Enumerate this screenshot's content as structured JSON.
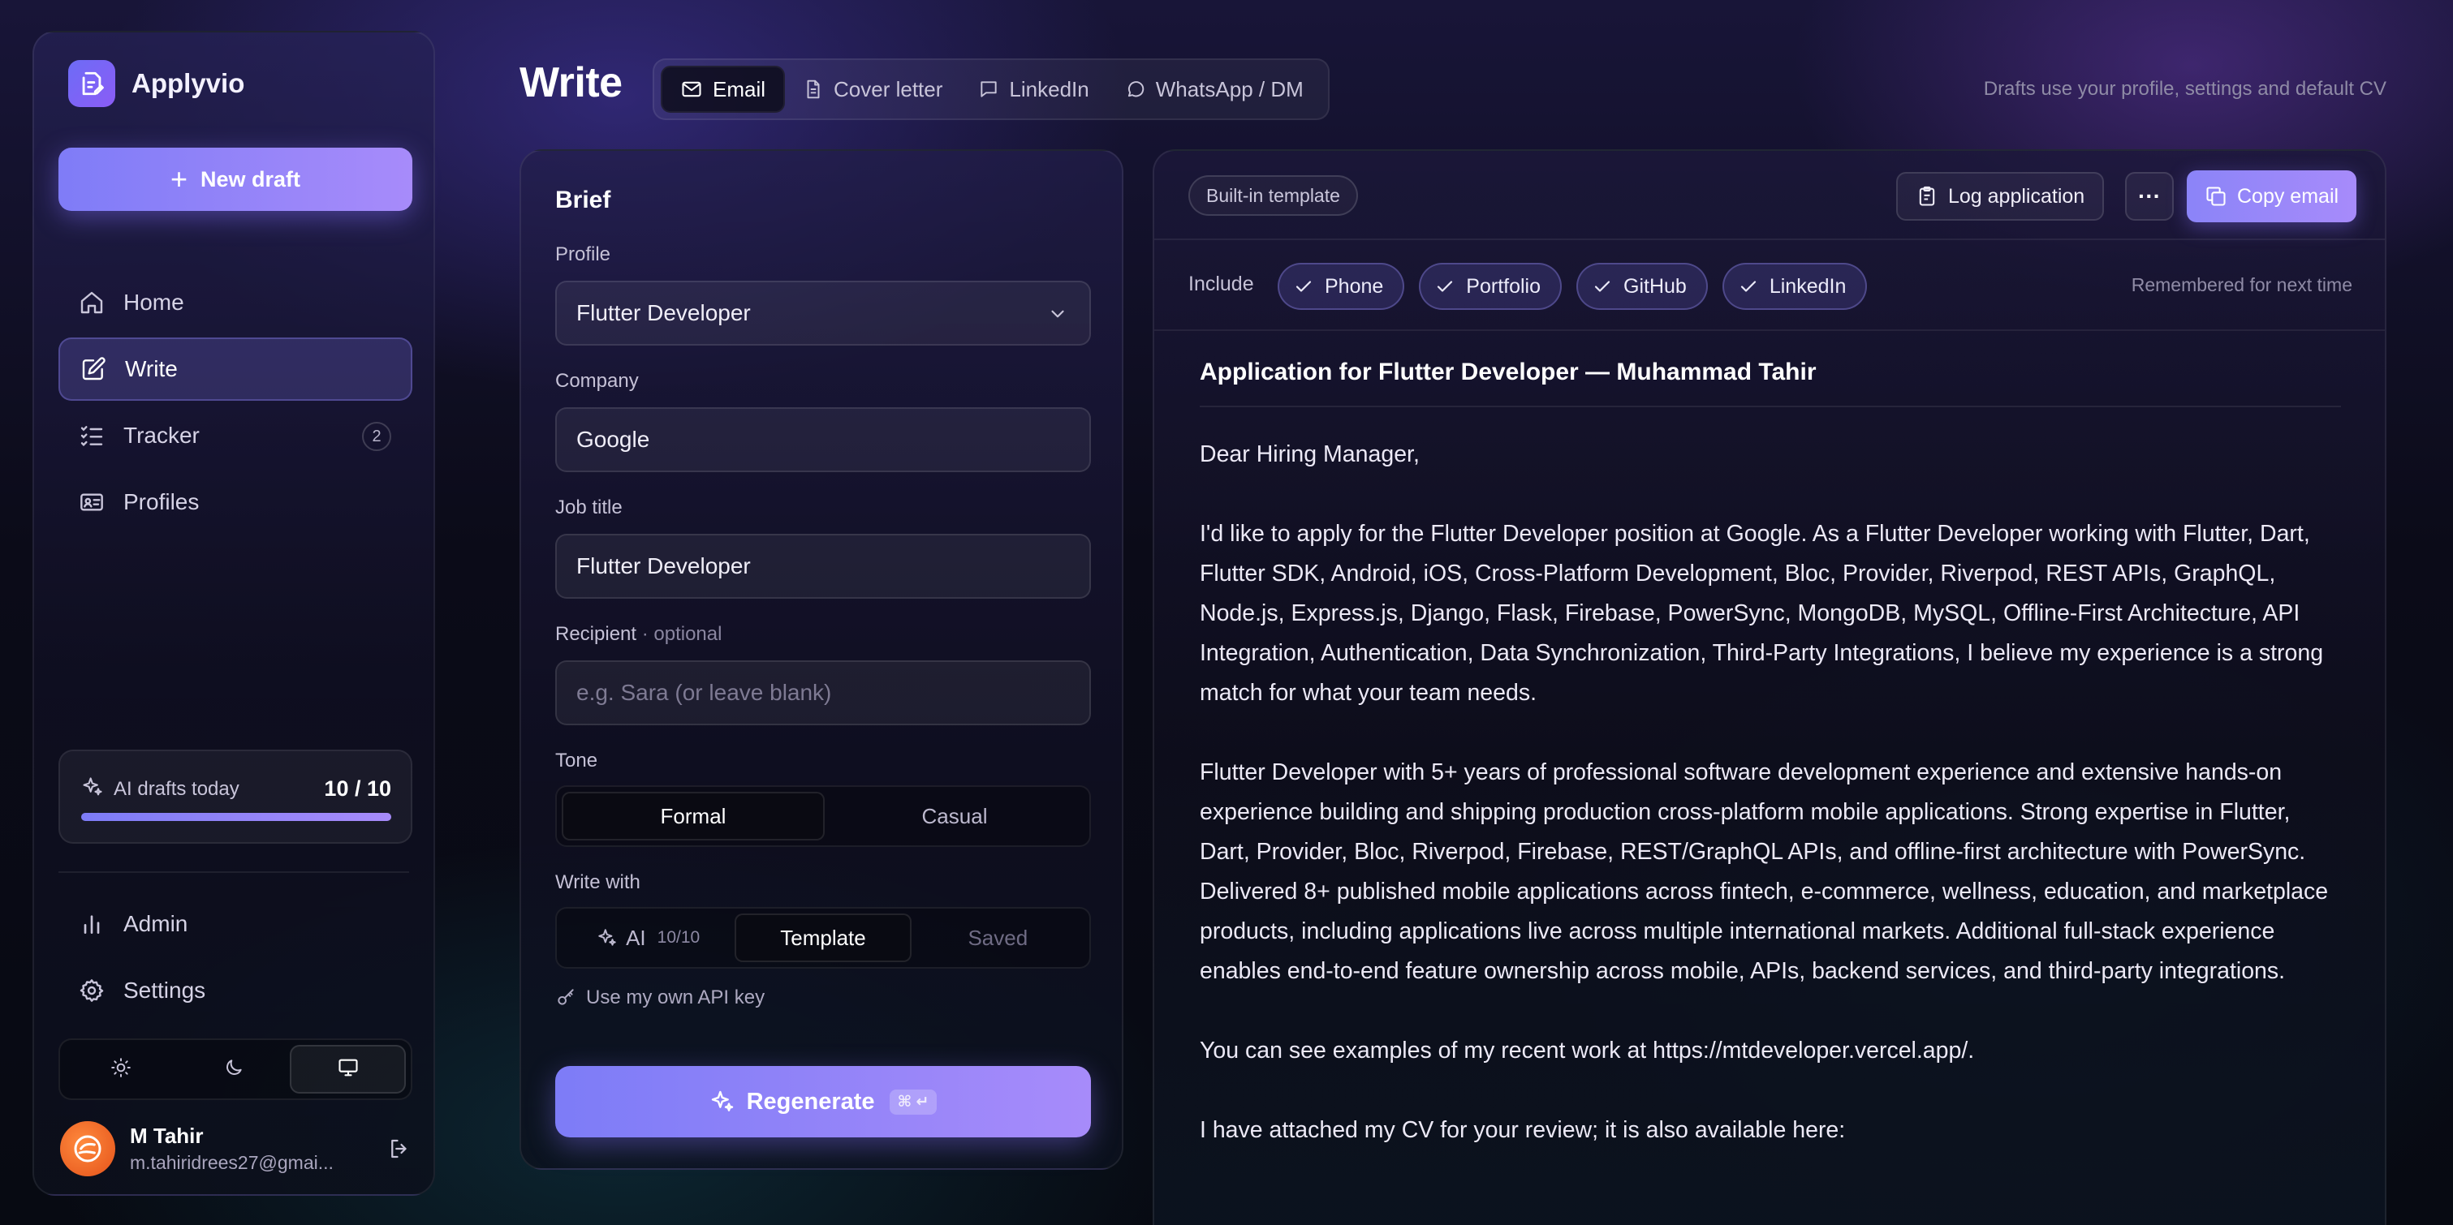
{
  "app": {
    "name": "Applyvio"
  },
  "sidebar": {
    "new_draft_label": "New draft",
    "nav": [
      {
        "label": "Home",
        "icon": "home-icon"
      },
      {
        "label": "Write",
        "icon": "edit-icon",
        "active": true
      },
      {
        "label": "Tracker",
        "icon": "checklist-icon",
        "badge": "2"
      },
      {
        "label": "Profiles",
        "icon": "id-card-icon"
      }
    ],
    "ai_drafts": {
      "label": "AI drafts today",
      "value": "10 / 10",
      "fraction": 1.0
    },
    "admin_label": "Admin",
    "settings_label": "Settings",
    "theme_options": [
      "light",
      "dark",
      "system"
    ],
    "theme_selected": "system",
    "user": {
      "name": "M Tahir",
      "email": "m.tahiridrees27@gmai..."
    }
  },
  "header": {
    "title": "Write",
    "tabs": [
      {
        "label": "Email",
        "icon": "mail-icon",
        "active": true
      },
      {
        "label": "Cover letter",
        "icon": "document-icon"
      },
      {
        "label": "LinkedIn",
        "icon": "message-square-icon"
      },
      {
        "label": "WhatsApp / DM",
        "icon": "message-circle-icon"
      }
    ],
    "note": "Drafts use your profile, settings and default CV"
  },
  "brief": {
    "title": "Brief",
    "profile_label": "Profile",
    "profile_value": "Flutter Developer",
    "company_label": "Company",
    "company_value": "Google",
    "job_title_label": "Job title",
    "job_title_value": "Flutter Developer",
    "recipient_label": "Recipient",
    "recipient_optional": " · optional",
    "recipient_placeholder": "e.g. Sara (or leave blank)",
    "tone_label": "Tone",
    "tone_options": [
      "Formal",
      "Casual"
    ],
    "tone_selected": "Formal",
    "write_with_label": "Write with",
    "write_with": {
      "ai_label": "AI",
      "ai_quota": "10/10",
      "template_label": "Template",
      "saved_label": "Saved",
      "selected": "Template"
    },
    "api_key_label": "Use my own API key",
    "regenerate_label": "Regenerate",
    "regenerate_shortcut": "⌘ ↵"
  },
  "preview": {
    "template_badge": "Built-in template",
    "log_button": "Log application",
    "more_button": "···",
    "copy_button": "Copy email",
    "include_label": "Include",
    "include_chips": [
      "Phone",
      "Portfolio",
      "GitHub",
      "LinkedIn"
    ],
    "remember_note": "Remembered for next time",
    "subject": "Application for Flutter Developer — Muhammad Tahir",
    "paragraphs": [
      "Dear Hiring Manager,",
      "I'd like to apply for the Flutter Developer position at Google. As a Flutter Developer working with Flutter, Dart, Flutter SDK, Android, iOS, Cross-Platform Development, Bloc, Provider, Riverpod, REST APIs, GraphQL, Node.js, Express.js, Django, Flask, Firebase, PowerSync, MongoDB, MySQL, Offline-First Architecture, API Integration, Authentication, Data Synchronization, Third-Party Integrations, I believe my experience is a strong match for what your team needs.",
      "Flutter Developer with 5+ years of professional software development experience and extensive hands-on experience building and shipping production cross-platform mobile applications. Strong expertise in Flutter, Dart, Provider, Bloc, Riverpod, Firebase, REST/GraphQL APIs, and offline-first architecture with PowerSync. Delivered 8+ published mobile applications across fintech, e-commerce, wellness, education, and marketplace products, including applications live across multiple international markets. Additional full-stack experience enables end-to-end feature ownership across mobile, APIs, backend services, and third-party integrations.",
      "You can see examples of my recent work at https://mtdeveloper.vercel.app/.",
      "I have attached my CV for your review; it is also available here:"
    ]
  },
  "colors": {
    "accent": "#8b84f8",
    "accent_2": "#a78bfa",
    "avatar": "#f07a2c"
  }
}
